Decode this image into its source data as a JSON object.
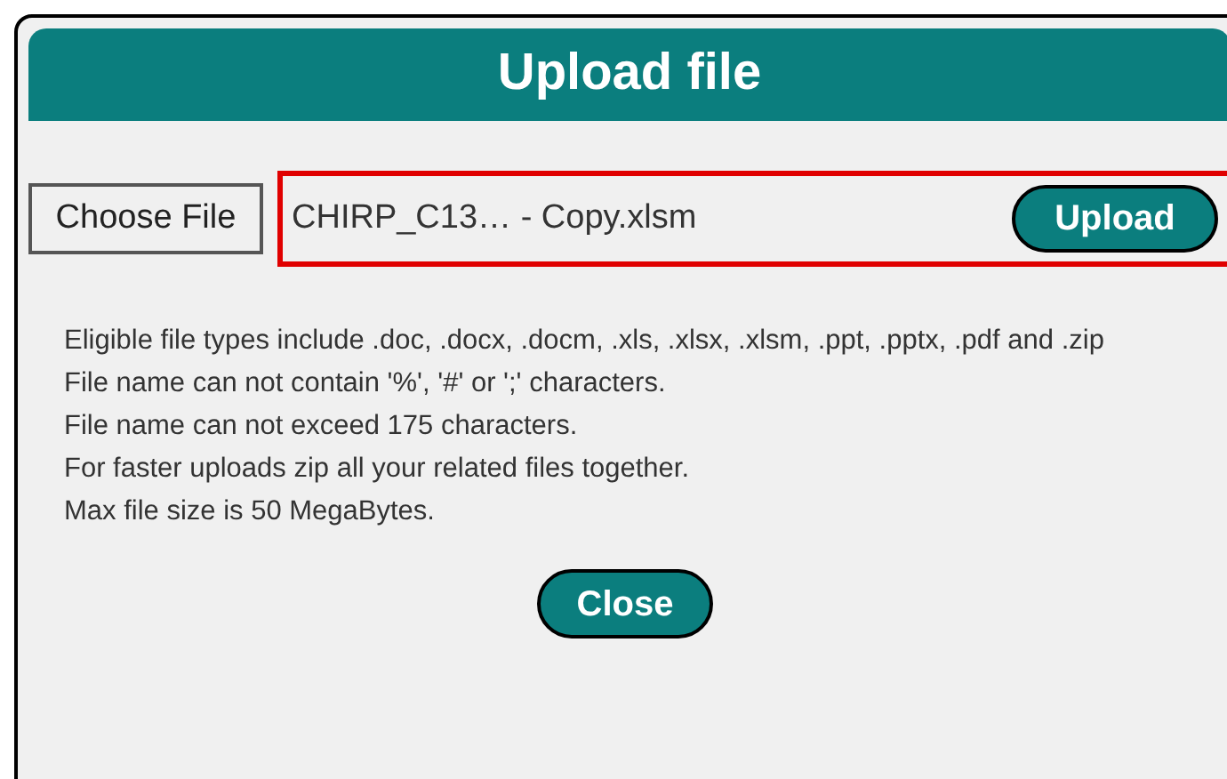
{
  "dialog": {
    "title": "Upload file",
    "choose_button": "Choose File",
    "file_field": {
      "value": "CHIRP_C13… - Copy.xlsm",
      "highlighted": true
    },
    "upload_button": "Upload",
    "info_lines": [
      "Eligible file types include .doc, .docx, .docm, .xls, .xlsx, .xlsm, .ppt, .pptx, .pdf and .zip",
      "File name can not contain '%', '#' or ';' characters.",
      "File name can not exceed 175 characters.",
      "For faster uploads zip all your related files together.",
      "Max file size is 50 MegaBytes."
    ],
    "close_button": "Close"
  }
}
